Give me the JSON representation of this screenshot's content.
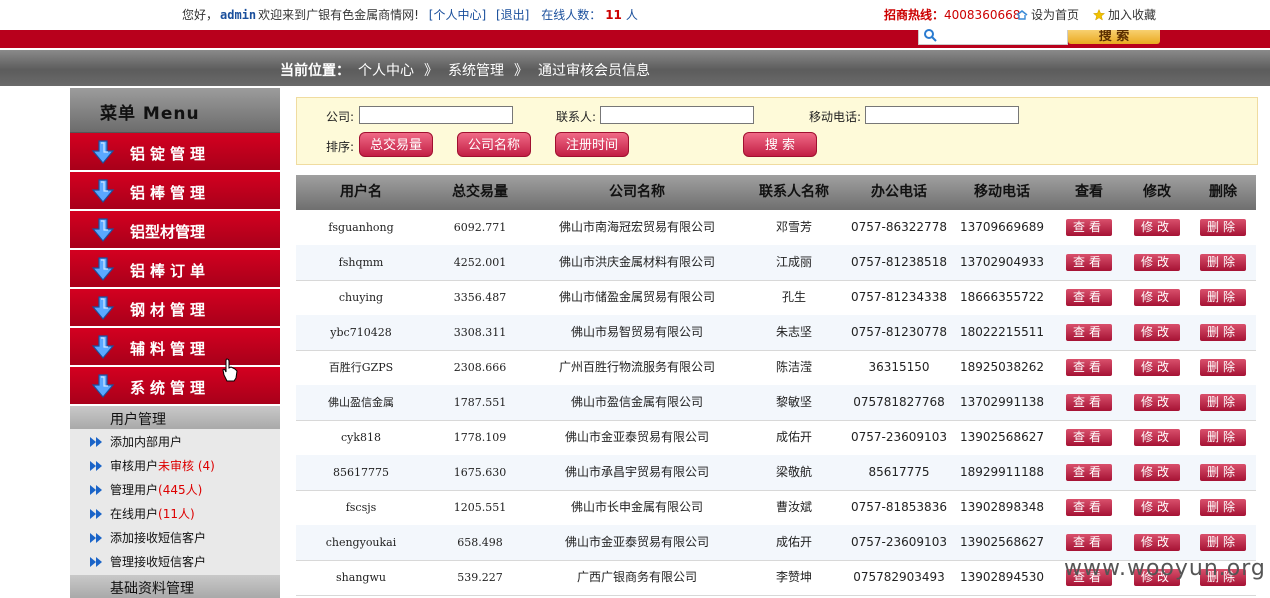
{
  "topbar": {
    "greeting": "您好，",
    "username": "admin",
    "welcome_text": "欢迎来到广银有色金属商情网!",
    "personal_center_link": "[个人中心]",
    "logout_link": "[退出]",
    "online_label": "在线人数：",
    "online_count": "11",
    "online_unit": "人",
    "hotline_label": "招商热线：",
    "hotline_number": "4008360668",
    "set_homepage": "设为首页",
    "add_favorite": "加入收藏"
  },
  "search": {
    "placeholder": "",
    "button_label": "搜 索"
  },
  "breadcrumb": {
    "label": "当前位置：",
    "items": [
      "个人中心",
      "系统管理",
      "通过审核会员信息"
    ],
    "separator": "》"
  },
  "sidebar": {
    "title": "菜单 Menu",
    "menu_items": [
      {
        "label": "铝锭管理"
      },
      {
        "label": "铝棒管理"
      },
      {
        "label": "铝型材管理"
      },
      {
        "label": "铝棒订单"
      },
      {
        "label": "钢材管理"
      },
      {
        "label": "辅料管理"
      },
      {
        "label": "系统管理"
      }
    ],
    "sub_section_title": "用户管理",
    "sub_items": [
      {
        "label": "添加内部用户",
        "extra": ""
      },
      {
        "label": "审核用户",
        "extra": "未审核 (4)"
      },
      {
        "label": "管理用户",
        "extra": "(445人)"
      },
      {
        "label": "在线用户",
        "extra": "(11人)"
      },
      {
        "label": "添加接收短信客户",
        "extra": ""
      },
      {
        "label": "管理接收短信客户",
        "extra": ""
      }
    ],
    "next_section_title": "基础资料管理"
  },
  "filter": {
    "company_label": "公司:",
    "company_value": "",
    "contact_label": "联系人:",
    "contact_value": "",
    "mobile_label": "移动电话:",
    "mobile_value": "",
    "sort_label": "排序:",
    "sort_buttons": [
      "总交易量",
      "公司名称",
      "注册时间"
    ],
    "search_button": "搜 索"
  },
  "table": {
    "headers": [
      "用户名",
      "总交易量",
      "公司名称",
      "联系人名称",
      "办公电话",
      "移动电话",
      "查看",
      "修改",
      "删除"
    ],
    "view_label": "查看",
    "edit_label": "修改",
    "delete_label": "删除",
    "rows": [
      {
        "username": "fsguanhong",
        "volume": "6092.771",
        "company": "佛山市南海冠宏贸易有限公司",
        "contact": "邓雪芳",
        "office": "0757-86322778",
        "mobile": "13709669689"
      },
      {
        "username": "fshqmm",
        "volume": "4252.001",
        "company": "佛山市洪庆金属材料有限公司",
        "contact": "江成丽",
        "office": "0757-81238518",
        "mobile": "13702904933"
      },
      {
        "username": "chuying",
        "volume": "3356.487",
        "company": "佛山市储盈金属贸易有限公司",
        "contact": "孔生",
        "office": "0757-81234338",
        "mobile": "18666355722"
      },
      {
        "username": "ybc710428",
        "volume": "3308.311",
        "company": "佛山市易智贸易有限公司",
        "contact": "朱志坚",
        "office": "0757-81230778",
        "mobile": "18022215511"
      },
      {
        "username": "百胜行GZPS",
        "volume": "2308.666",
        "company": "广州百胜行物流服务有限公司",
        "contact": "陈洁滢",
        "office": "36315150",
        "mobile": "18925038262"
      },
      {
        "username": "佛山盈信金属",
        "volume": "1787.551",
        "company": "佛山市盈信金属有限公司",
        "contact": "黎敏坚",
        "office": "075781827768",
        "mobile": "13702991138"
      },
      {
        "username": "cyk818",
        "volume": "1778.109",
        "company": "佛山市金亚泰贸易有限公司",
        "contact": "成佑开",
        "office": "0757-23609103",
        "mobile": "13902568627"
      },
      {
        "username": "85617775",
        "volume": "1675.630",
        "company": "佛山市承昌宇贸易有限公司",
        "contact": "梁敬航",
        "office": "85617775",
        "mobile": "18929911188"
      },
      {
        "username": "fscsjs",
        "volume": "1205.551",
        "company": "佛山市长申金属有限公司",
        "contact": "曹汝斌",
        "office": "0757-81853836",
        "mobile": "13902898348"
      },
      {
        "username": "chengyoukai",
        "volume": "658.498",
        "company": "佛山市金亚泰贸易有限公司",
        "contact": "成佑开",
        "office": "0757-23609103",
        "mobile": "13902568627"
      },
      {
        "username": "shangwu",
        "volume": "539.227",
        "company": "广西广银商务有限公司",
        "contact": "李赞坤",
        "office": "075782903493",
        "mobile": "13902894530"
      }
    ]
  },
  "watermark": "www.wooyun.org",
  "colors": {
    "brand_red": "#b8001c",
    "menu_red": "#c8001e",
    "button_pink": "#c21e44",
    "filter_bg": "#fefad9"
  }
}
